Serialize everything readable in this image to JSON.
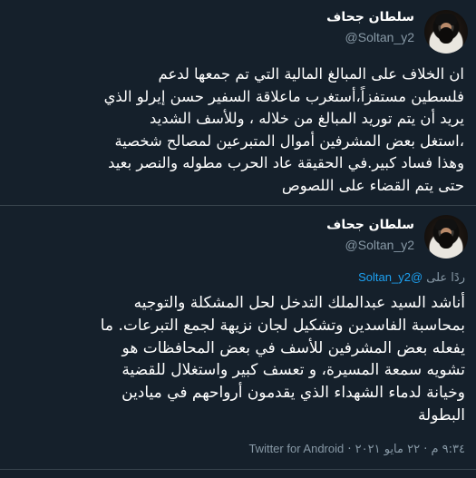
{
  "tweet1": {
    "name": "سلطان جحاف",
    "handle": "@Soltan_y2",
    "lines": [
      "ان الخلاف على المبالغ المالية التي تم جمعها لدعم",
      "فلسطين مستفزاً،أستغرب ماعلاقة السفير حسن إيرلو الذي",
      "يريد أن يتم توريد المبالغ من خلاله ، وللأسف الشديد",
      "،استغل بعض المشرفين أموال المتبرعين لمصالح شخصية",
      "وهذا فساد كبير.في الحقيقة عاد الحرب مطوله والنصر بعيد",
      "حتى يتم القضاء على اللصوص"
    ]
  },
  "tweet2": {
    "name": "سلطان جحاف",
    "handle": "@Soltan_y2",
    "reply_prefix": "ردًا على",
    "reply_handle": "@Soltan_y2",
    "lines": [
      "أناشد السيد عبدالملك التدخل لحل المشكلة والتوجيه",
      "بمحاسبة الفاسدين وتشكيل لجان نزيهة لجمع التبرعات. ما",
      "يفعله بعض المشرفين للأسف في بعض المحافظات هو",
      "تشويه سمعة المسيرة، و تعسف كبير واستغلال للقضية",
      "وخيانة لدماء الشهداء الذي يقدمون أرواحهم في ميادين",
      "البطولة"
    ],
    "timestamp": "٩:٣٤ م · ٢٢ مايو ٢٠٢١",
    "separator": "·",
    "source": "Twitter for Android"
  }
}
